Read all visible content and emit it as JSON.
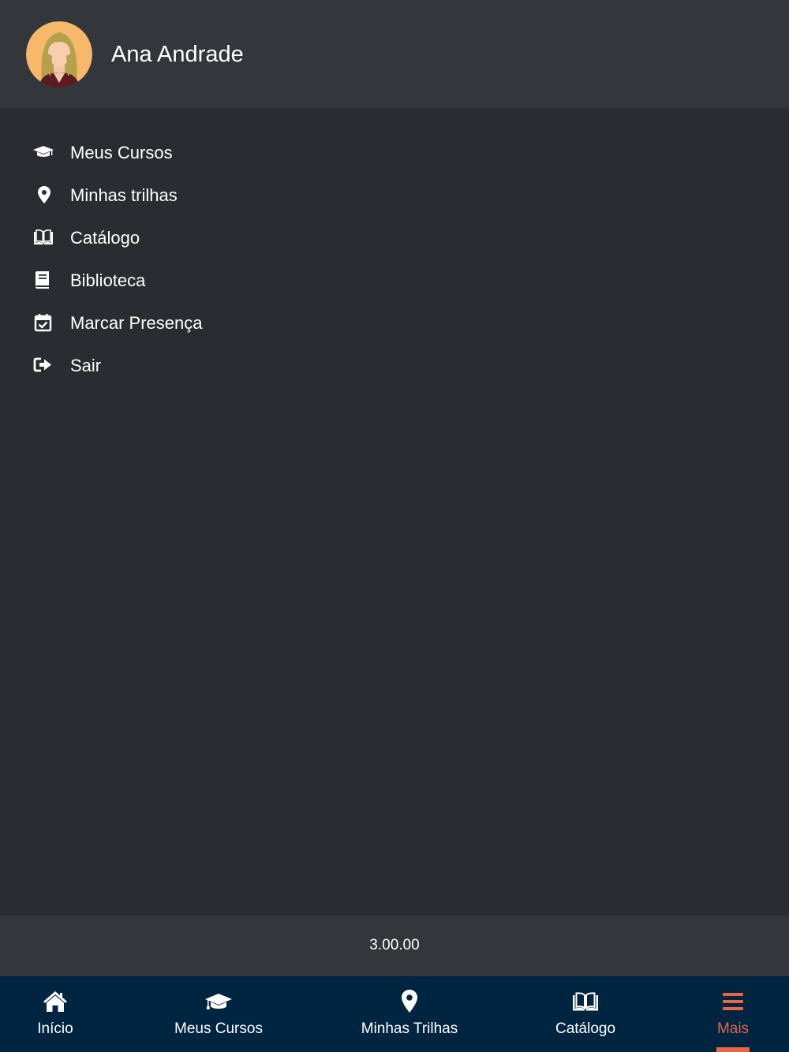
{
  "profile": {
    "name": "Ana Andrade",
    "avatar_icon": "user-avatar-woman"
  },
  "menu": {
    "items": [
      {
        "label": "Meus Cursos",
        "icon": "graduation-cap-icon"
      },
      {
        "label": "Minhas trilhas",
        "icon": "map-pin-icon"
      },
      {
        "label": "Catálogo",
        "icon": "open-book-icon"
      },
      {
        "label": "Biblioteca",
        "icon": "book-icon"
      },
      {
        "label": "Marcar Presença",
        "icon": "calendar-check-icon"
      },
      {
        "label": "Sair",
        "icon": "sign-out-icon"
      }
    ]
  },
  "version": "3.00.00",
  "bottom_nav": {
    "items": [
      {
        "label": "Início",
        "icon": "home-icon",
        "active": false
      },
      {
        "label": "Meus Cursos",
        "icon": "graduation-cap-icon",
        "active": false
      },
      {
        "label": "Minhas Trilhas",
        "icon": "map-pin-icon",
        "active": false
      },
      {
        "label": "Catálogo",
        "icon": "open-book-icon",
        "active": false
      },
      {
        "label": "Mais",
        "icon": "hamburger-menu-icon",
        "active": true
      }
    ]
  },
  "colors": {
    "background": "#292c30",
    "header_background": "#33363a",
    "bottom_nav_background": "#002541",
    "accent": "#e8654a",
    "text": "#ffffff"
  }
}
